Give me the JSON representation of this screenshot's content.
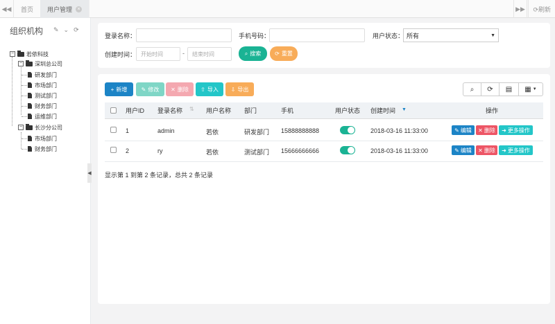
{
  "tabs": {
    "nav_left": "◀◀",
    "home": "首页",
    "active": "用户管理",
    "close": "×",
    "nav_right": "▶▶",
    "refresh": "⟳刷新"
  },
  "sidebar": {
    "title": "组织机构",
    "tree": {
      "root": "若依科技",
      "branches": [
        {
          "name": "深圳总公司",
          "children": [
            "研发部门",
            "市场部门",
            "测试部门",
            "财务部门",
            "运维部门"
          ]
        },
        {
          "name": "长沙分公司",
          "children": [
            "市场部门",
            "财务部门"
          ]
        }
      ]
    }
  },
  "search": {
    "login_name_label": "登录名称：",
    "phone_label": "手机号码：",
    "status_label": "用户状态：",
    "status_value": "所有",
    "create_time_label": "创建时间：",
    "start_placeholder": "开始时间",
    "dash": "-",
    "end_placeholder": "结束时间",
    "search_btn": "搜索",
    "reset_btn": "重置"
  },
  "toolbar": {
    "add": "新增",
    "edit": "修改",
    "delete": "删除",
    "import": "导入",
    "export": "导出"
  },
  "table": {
    "headers": {
      "user_id": "用户ID",
      "login_name": "登录名称",
      "user_name": "用户名称",
      "dept": "部门",
      "phone": "手机",
      "status": "用户状态",
      "create_time": "创建时间",
      "ops": "操作"
    },
    "rows": [
      {
        "id": "1",
        "login": "admin",
        "name": "若依",
        "dept": "研发部门",
        "phone": "15888888888",
        "status_on": true,
        "time": "2018-03-16 11:33:00"
      },
      {
        "id": "2",
        "login": "ry",
        "name": "若依",
        "dept": "测试部门",
        "phone": "15666666666",
        "status_on": true,
        "time": "2018-03-16 11:33:00"
      }
    ],
    "row_actions": {
      "edit": "编辑",
      "delete": "删除",
      "more": "更多操作"
    },
    "summary": "显示第 1 到第 2 条记录，总共 2 条记录"
  },
  "colors": {
    "primary": "#1c84c6",
    "success": "#1ab394",
    "danger": "#ed5565",
    "info": "#23c6c8",
    "warning": "#f8ac59"
  }
}
